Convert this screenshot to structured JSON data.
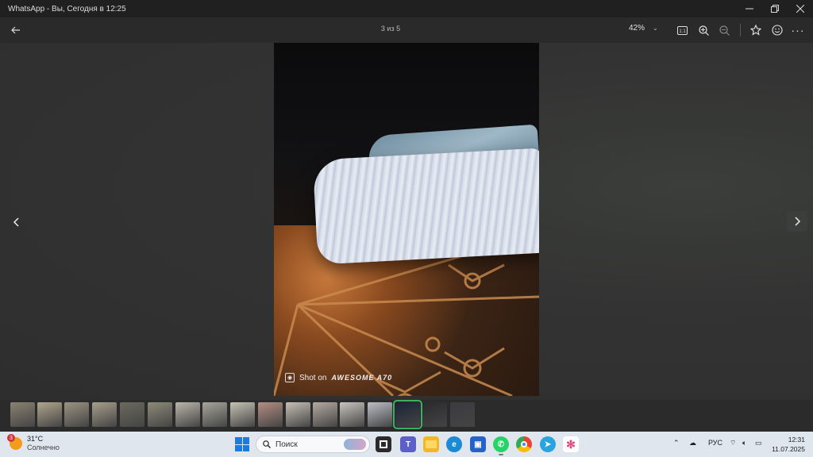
{
  "window": {
    "title": "WhatsApp - Вы, Сегодня в 12:25",
    "minimize_icon": "minimize-icon",
    "restore_icon": "restore-icon",
    "close_icon": "close-icon"
  },
  "toolbar": {
    "counter": "3 из 5",
    "zoom": "42%",
    "actual_size_label": "1:1"
  },
  "photo": {
    "watermark_prefix": "Shot on",
    "watermark_brand": "AWESOME A70"
  },
  "thumbnails": {
    "count": 17,
    "active_index": 14
  },
  "taskbar": {
    "weather_temp": "31°C",
    "weather_condition": "Солнечно",
    "weather_badge": "3",
    "search_placeholder": "Поиск",
    "language": "РУС",
    "time": "12:31",
    "date": "11.07.2025",
    "accent": "#1f7ae0"
  }
}
